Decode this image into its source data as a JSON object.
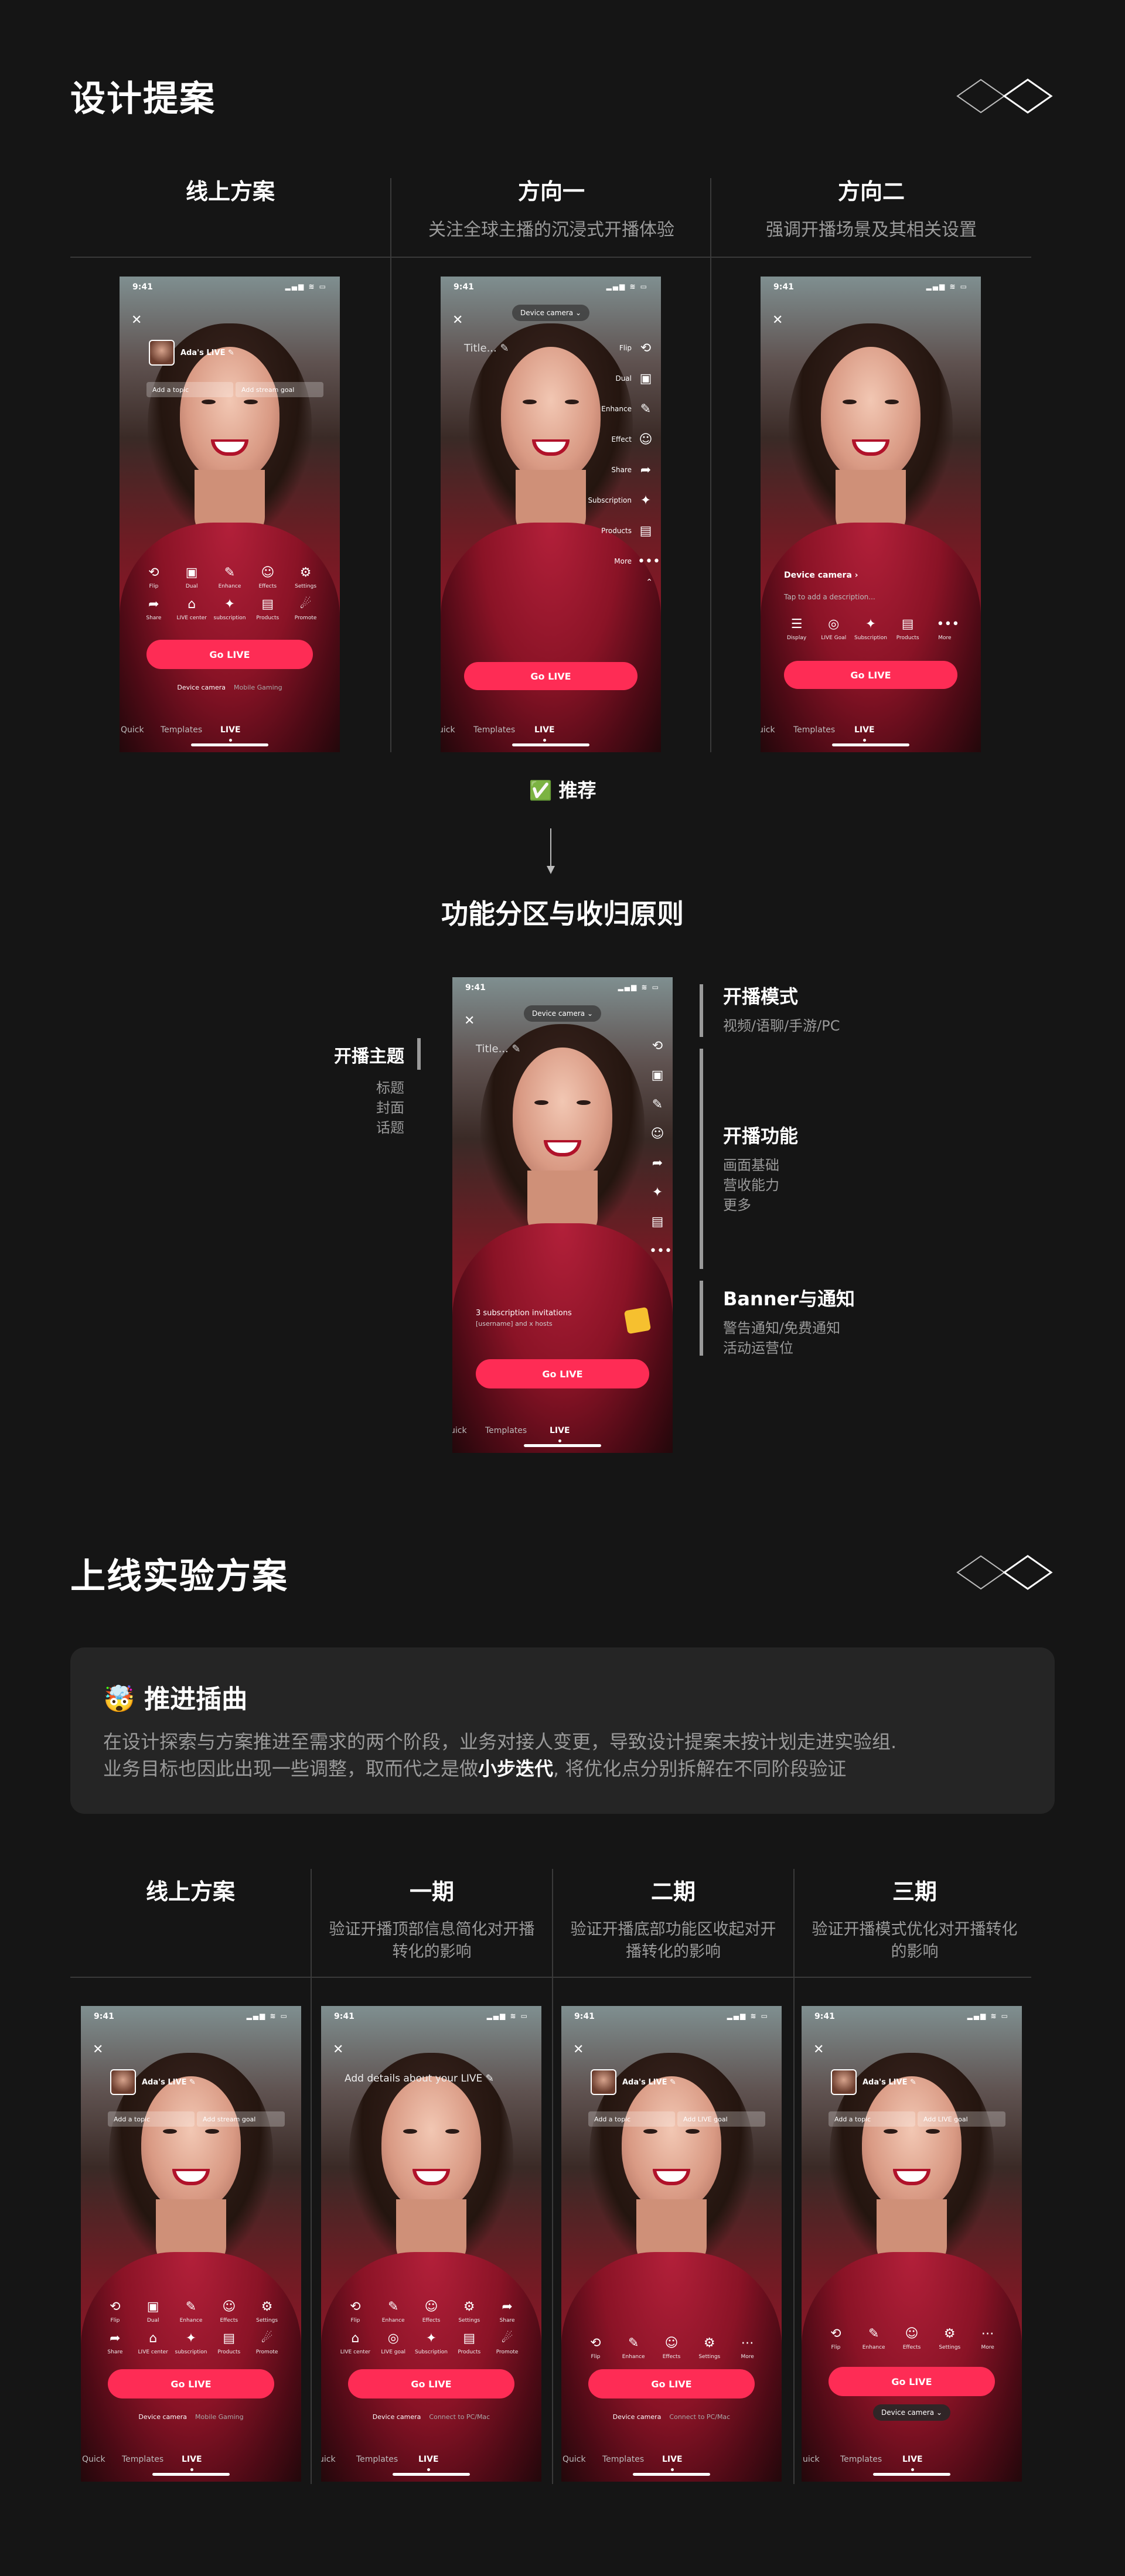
{
  "section1": {
    "title": "设计提案",
    "columns": [
      {
        "heading": "线上方案",
        "sub": ""
      },
      {
        "heading": "方向一",
        "sub": "关注全球主播的沉浸式开播体验"
      },
      {
        "heading": "方向二",
        "sub": "强调开播场景及其相关设置"
      }
    ],
    "recommend": "✅ 推荐",
    "principle_title": "功能分区与收归原则"
  },
  "phone": {
    "time": "9:41",
    "status_icons": "▂▄▆ ≋ ▭",
    "close": "✕",
    "go_live": "Go LIVE",
    "mode_quick": "Quick",
    "mode_templates": "Templates",
    "mode_live": "LIVE",
    "mode_uick": "uick",
    "host_name": "Ada's LIVE ✎",
    "add_topic": "Add a topic",
    "add_goal": "Add stream goal",
    "add_live_goal": "Add LIVE goal",
    "device_camera": "Device camera",
    "mobile_gaming": "Mobile Gaming",
    "connect_pc": "Connect to PC/Mac",
    "title_placeholder": "Title... ✎",
    "device_camera_chip": "Device camera ⌄",
    "device_camera_arrow": "Device camera ›",
    "tap_desc": "Tap to add a description...",
    "add_details": "Add details about your LIVE ✎",
    "more": "More",
    "sub_invites": "3 subscription invitations",
    "sub_hosts": "[username] and x hosts"
  },
  "grid_online": [
    {
      "icon": "⟲",
      "label": "Flip"
    },
    {
      "icon": "▣",
      "label": "Dual"
    },
    {
      "icon": "✎",
      "label": "Enhance"
    },
    {
      "icon": "☺",
      "label": "Effects"
    },
    {
      "icon": "⚙",
      "label": "Settings"
    },
    {
      "icon": "➦",
      "label": "Share"
    },
    {
      "icon": "⌂",
      "label": "LIVE center"
    },
    {
      "icon": "✦",
      "label": "subscription"
    },
    {
      "icon": "▤",
      "label": "Products"
    },
    {
      "icon": "☄",
      "label": "Promote"
    }
  ],
  "sidebar_dir1": [
    {
      "label": "Flip",
      "icon": "⟲"
    },
    {
      "label": "Dual",
      "icon": "▣"
    },
    {
      "label": "Enhance",
      "icon": "✎"
    },
    {
      "label": "Effect",
      "icon": "☺"
    },
    {
      "label": "Share",
      "icon": "➦"
    },
    {
      "label": "Subscription",
      "icon": "✦"
    },
    {
      "label": "Products",
      "icon": "▤"
    },
    {
      "label": "More",
      "icon": "•••"
    }
  ],
  "grid_dir2": [
    {
      "icon": "☰",
      "label": "Display"
    },
    {
      "icon": "◎",
      "label": "LIVE Goal"
    },
    {
      "icon": "✦",
      "label": "Subscription"
    },
    {
      "icon": "▤",
      "label": "Products"
    },
    {
      "icon": "•••",
      "label": "More"
    }
  ],
  "principles": {
    "left_title": "开播主题",
    "left_desc": [
      "标题",
      "封面",
      "话题"
    ],
    "r1_title": "开播模式",
    "r1_desc": "视频/语聊/手游/PC",
    "r2_title": "开播功能",
    "r2_desc": [
      "画面基础",
      "营收能力",
      "更多"
    ],
    "r3_title": "Banner与通知",
    "r3_desc": [
      "警告通知/免费通知",
      "活动运营位"
    ]
  },
  "section2": {
    "title": "上线实验方案",
    "card_title": "🤯 推进插曲",
    "card_line1": "在设计探索与方案推进至需求的两个阶段，业务对接人变更，导致设计提案未按计划走进实验组.",
    "card_line2a": "业务目标也因此出现一些调整，取而代之是做",
    "card_line2b": "小步迭代",
    "card_line2c": ", 将优化点分别拆解在不同阶段验证",
    "columns": [
      {
        "heading": "线上方案",
        "sub": ""
      },
      {
        "heading": "一期",
        "sub": "验证开播顶部信息简化对开播转化的影响"
      },
      {
        "heading": "二期",
        "sub": "验证开播底部功能区收起对开播转化的影响"
      },
      {
        "heading": "三期",
        "sub": "验证开播模式优化对开播转化的影响"
      }
    ]
  },
  "grid_p1": [
    {
      "icon": "⟲",
      "label": "Flip"
    },
    {
      "icon": "✎",
      "label": "Enhance"
    },
    {
      "icon": "☺",
      "label": "Effects"
    },
    {
      "icon": "⚙",
      "label": "Settings"
    },
    {
      "icon": "➦",
      "label": "Share"
    },
    {
      "icon": "⌂",
      "label": "LIVE center"
    },
    {
      "icon": "◎",
      "label": "LIVE goal"
    },
    {
      "icon": "✦",
      "label": "Subscription"
    },
    {
      "icon": "▤",
      "label": "Products"
    },
    {
      "icon": "☄",
      "label": "Promote"
    }
  ],
  "grid_p2": [
    {
      "icon": "⟲",
      "label": "Flip"
    },
    {
      "icon": "✎",
      "label": "Enhance"
    },
    {
      "icon": "☺",
      "label": "Effects"
    },
    {
      "icon": "⚙",
      "label": "Settings"
    },
    {
      "icon": "⋯",
      "label": "More"
    }
  ]
}
